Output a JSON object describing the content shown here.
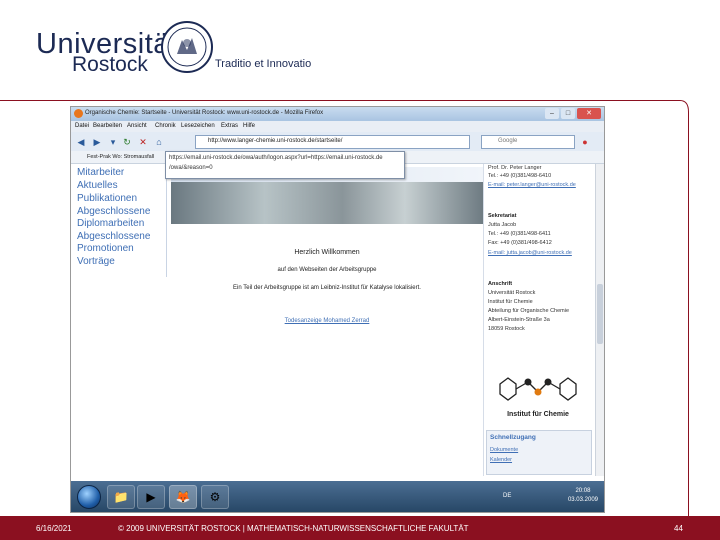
{
  "slide": {
    "logo_line1": "Universität",
    "logo_line2": "Rostock",
    "tagline": "Traditio et Innovatio",
    "footer_date": "6/16/2021",
    "footer_center": "© 2009 UNIVERSITÄT ROSTOCK | MATHEMATISCH-NATURWISSENSCHAFTLICHE FAKULTÄT",
    "footer_page": "44",
    "accent_color": "#8b1020"
  },
  "browser": {
    "title": "Organische Chemie: Startseite - Universität Rostock: www.uni-rostock.de - Mozilla Firefox",
    "menu": [
      "Datei",
      "Bearbeiten",
      "Ansicht",
      "Chronik",
      "Lesezeichen",
      "Extras",
      "Hilfe"
    ],
    "url": "http://www.langer-chemie.uni-rostock.de/startseite/",
    "search_placeholder": "Google",
    "bookmark1": "Fest-Prak Wo: Stromausfall",
    "dropdown_line1": "https://email.uni-rostock.de/owa/auth/logon.aspx?url=https://email.uni-rostock.de",
    "dropdown_line2": "/owa/&reason=0"
  },
  "page": {
    "nav": [
      "Mitarbeiter",
      "Aktuelles",
      "Publikationen",
      "Abgeschlossene",
      "Diplomarbeiten",
      "Abgeschlossene",
      "Promotionen",
      "Vorträge"
    ],
    "welcome_title": "Herzlich Willkommen",
    "welcome_sub": "auf den Webseiten der Arbeitsgruppe",
    "welcome_text": "Ein Teil der Arbeitsgruppe ist am Leibniz-Institut für Katalyse lokalisiert.",
    "obituary_link": "Todesanzeige Mohamed Zerrad",
    "right": {
      "prof": "Prof. Dr. Peter Langer",
      "prof_tel": "Tel.: +49 (0)381/498-6410",
      "prof_email": "E-mail: peter.langer@uni-rostock.de",
      "sec_head": "Sekretariat",
      "sec_name": "Jutta Jacob",
      "sec_tel": "Tel.: +49 (0)381/498-6411",
      "sec_fax": "Fax: +49 (0)381/498-6412",
      "sec_email": "E-mail: jutta.jacob@uni-rostock.de",
      "addr_head": "Anschrift",
      "addr": [
        "Universität Rostock",
        "Institut für Chemie",
        "Abteilung für Organische Chemie",
        "Albert-Einstein-Straße 3a",
        "18059 Rostock"
      ],
      "logo_caption": "Institut für Chemie",
      "quick_head": "Schnellzugang",
      "quick_links": [
        "Dokumente",
        "Kalender"
      ]
    }
  },
  "taskbar": {
    "lang": "DE",
    "time": "20:08",
    "date": "03.03.2009"
  }
}
